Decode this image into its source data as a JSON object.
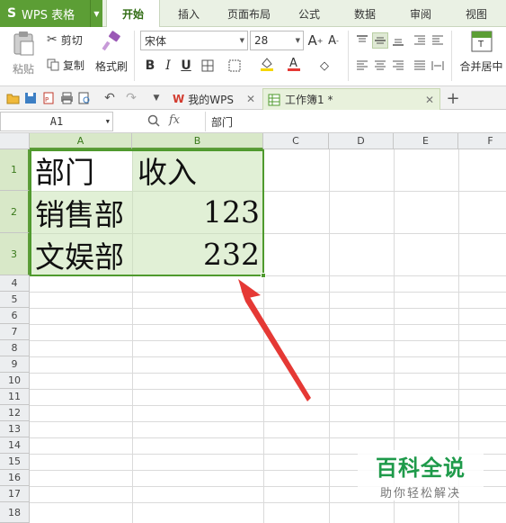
{
  "app": {
    "title": "WPS 表格",
    "logo": "S"
  },
  "menu_tabs": [
    "开始",
    "插入",
    "页面布局",
    "公式",
    "数据",
    "审阅",
    "视图"
  ],
  "active_tab": "开始",
  "ribbon": {
    "paste": "粘贴",
    "cut": "剪切",
    "copy": "复制",
    "format_painter": "格式刷",
    "font_name": "宋体",
    "font_size": "28",
    "merge_center": "合并居中"
  },
  "doc_tabs": [
    {
      "label": "我的WPS",
      "active": false
    },
    {
      "label": "工作簿1 *",
      "active": true
    }
  ],
  "formula_bar": {
    "cell_ref": "A1",
    "fx": "fx",
    "content": "部门"
  },
  "columns": [
    "A",
    "B",
    "C",
    "D",
    "E",
    "F"
  ],
  "rows": [
    "1",
    "2",
    "3",
    "4",
    "5",
    "6",
    "7",
    "8",
    "9",
    "10",
    "11",
    "12",
    "13",
    "14",
    "15",
    "16",
    "17",
    "18"
  ],
  "cells": {
    "a1": "部门",
    "b1": "收入",
    "a2": "销售部",
    "b2": "123",
    "a3": "文娱部",
    "b3": "232"
  },
  "watermark": {
    "title": "百科全说",
    "subtitle": "助你轻松解决"
  },
  "colors": {
    "accent": "#5c9e35",
    "selection": "#4f9a2e",
    "arrow": "#e53935",
    "watermark": "#1e9a4a"
  }
}
